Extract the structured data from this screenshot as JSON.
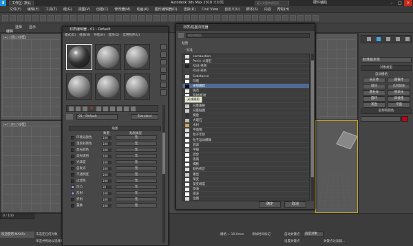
{
  "titlebar": {
    "app_logo": "3ds-max-logo",
    "workspace": "工作区: 默认",
    "title": "Autodesk 3ds Max 2018",
    "title_suffix": "无标题",
    "search_placeholder": "键入关键字或短语",
    "user": "硬件辅助",
    "minimize": "–",
    "maximize": "□",
    "close": "✕"
  },
  "menubar": [
    "文件(F)",
    "编辑(E)",
    "工具(T)",
    "组(G)",
    "视图(V)",
    "创建(C)",
    "修改器(M)",
    "动画(A)",
    "图形编辑器(D)",
    "渲染(R)",
    "Civil View",
    "自定义(U)",
    "脚本(S)",
    "内容",
    "帮助(H)"
  ],
  "left_tabs": {
    "select": "选择",
    "display": "显示",
    "edit": "编辑"
  },
  "viewport_labels": {
    "top_left": "[+] [顶] [线框]",
    "front_left": "[+] [左] [线框]",
    "perspective": "[+] [透视] [默认明暗处理]"
  },
  "material_editor": {
    "title": "材质编辑器 - 01 - Default",
    "menu": [
      "模式(D)",
      "材质(M)",
      "导航(N)",
      "选项(O)",
      "实用程序(U)"
    ],
    "material_name": "01 - Default",
    "material_type": "Standard",
    "maps_header": "贴图",
    "col_amount": "数量",
    "col_maptype": "贴图类型",
    "maps": [
      {
        "name": "环境光颜色",
        "amount": "100",
        "slot": "无"
      },
      {
        "name": "漫反射颜色",
        "amount": "100",
        "slot": "无"
      },
      {
        "name": "高光颜色",
        "amount": "100",
        "slot": "无"
      },
      {
        "name": "高光级别",
        "amount": "100",
        "slot": "无"
      },
      {
        "name": "光泽度",
        "amount": "100",
        "slot": "无"
      },
      {
        "name": "自发光",
        "amount": "100",
        "slot": "无"
      },
      {
        "name": "不透明度",
        "amount": "100",
        "slot": "无"
      },
      {
        "name": "过滤色",
        "amount": "100",
        "slot": "无"
      },
      {
        "name": "凹凸",
        "amount": "30",
        "slot": "无",
        "checked": true
      },
      {
        "name": "反射",
        "amount": "100",
        "slot": "无",
        "checked": true
      },
      {
        "name": "折射",
        "amount": "100",
        "slot": "无"
      },
      {
        "name": "置换",
        "amount": "100",
        "slot": "无"
      }
    ]
  },
  "browser": {
    "title": "材质/贴图浏览器",
    "search_placeholder": "按名称搜索...",
    "section": "贴图",
    "group": "- 标准",
    "items": [
      "combustion",
      "Perlin 大理石",
      "RGB 倍增",
      "RGB 染色",
      "Substance",
      "凹痕",
      "光线跟踪",
      "斑点",
      "反射/折射",
      "合成",
      "向量置换",
      "向量贴图",
      "棋盘",
      "大理石",
      "木材",
      "平面镜",
      "粒子年龄",
      "粒子运动模糊",
      "衰减",
      "平铺",
      "混合",
      "泼溅",
      "细胞",
      "颜色修正",
      "输出",
      "渐变",
      "渐变坡度",
      "旋涡",
      "噪波",
      "位图"
    ],
    "selected_index": 6,
    "tooltip": "光线跟踪",
    "ok": "确定",
    "cancel": "取消"
  },
  "command_panel": {
    "dropdown": "标准基本体",
    "rollout_object_type": "对象类型",
    "autogrid": "自动栅格",
    "buttons": [
      "长方体",
      "圆锥体",
      "球体",
      "几何球体",
      "圆柱体",
      "管状体",
      "圆环",
      "四棱锥",
      "茶壶",
      "平面"
    ],
    "rollout_name_color": "名称和颜色",
    "color_hex": "#c2001a"
  },
  "status": {
    "frame": "0 / 100",
    "selection": "未选定任何对象",
    "hint": "单击并拖动以选择并移动对象",
    "welcome": "欢迎使用 MAXSc",
    "add_time": "添加时间标记",
    "grid": "栅格 = 10.0mm",
    "autokey": "自动关键点",
    "setkey": "设置关键点",
    "selected": "选定对象",
    "filter": "关键点过滤器..."
  }
}
